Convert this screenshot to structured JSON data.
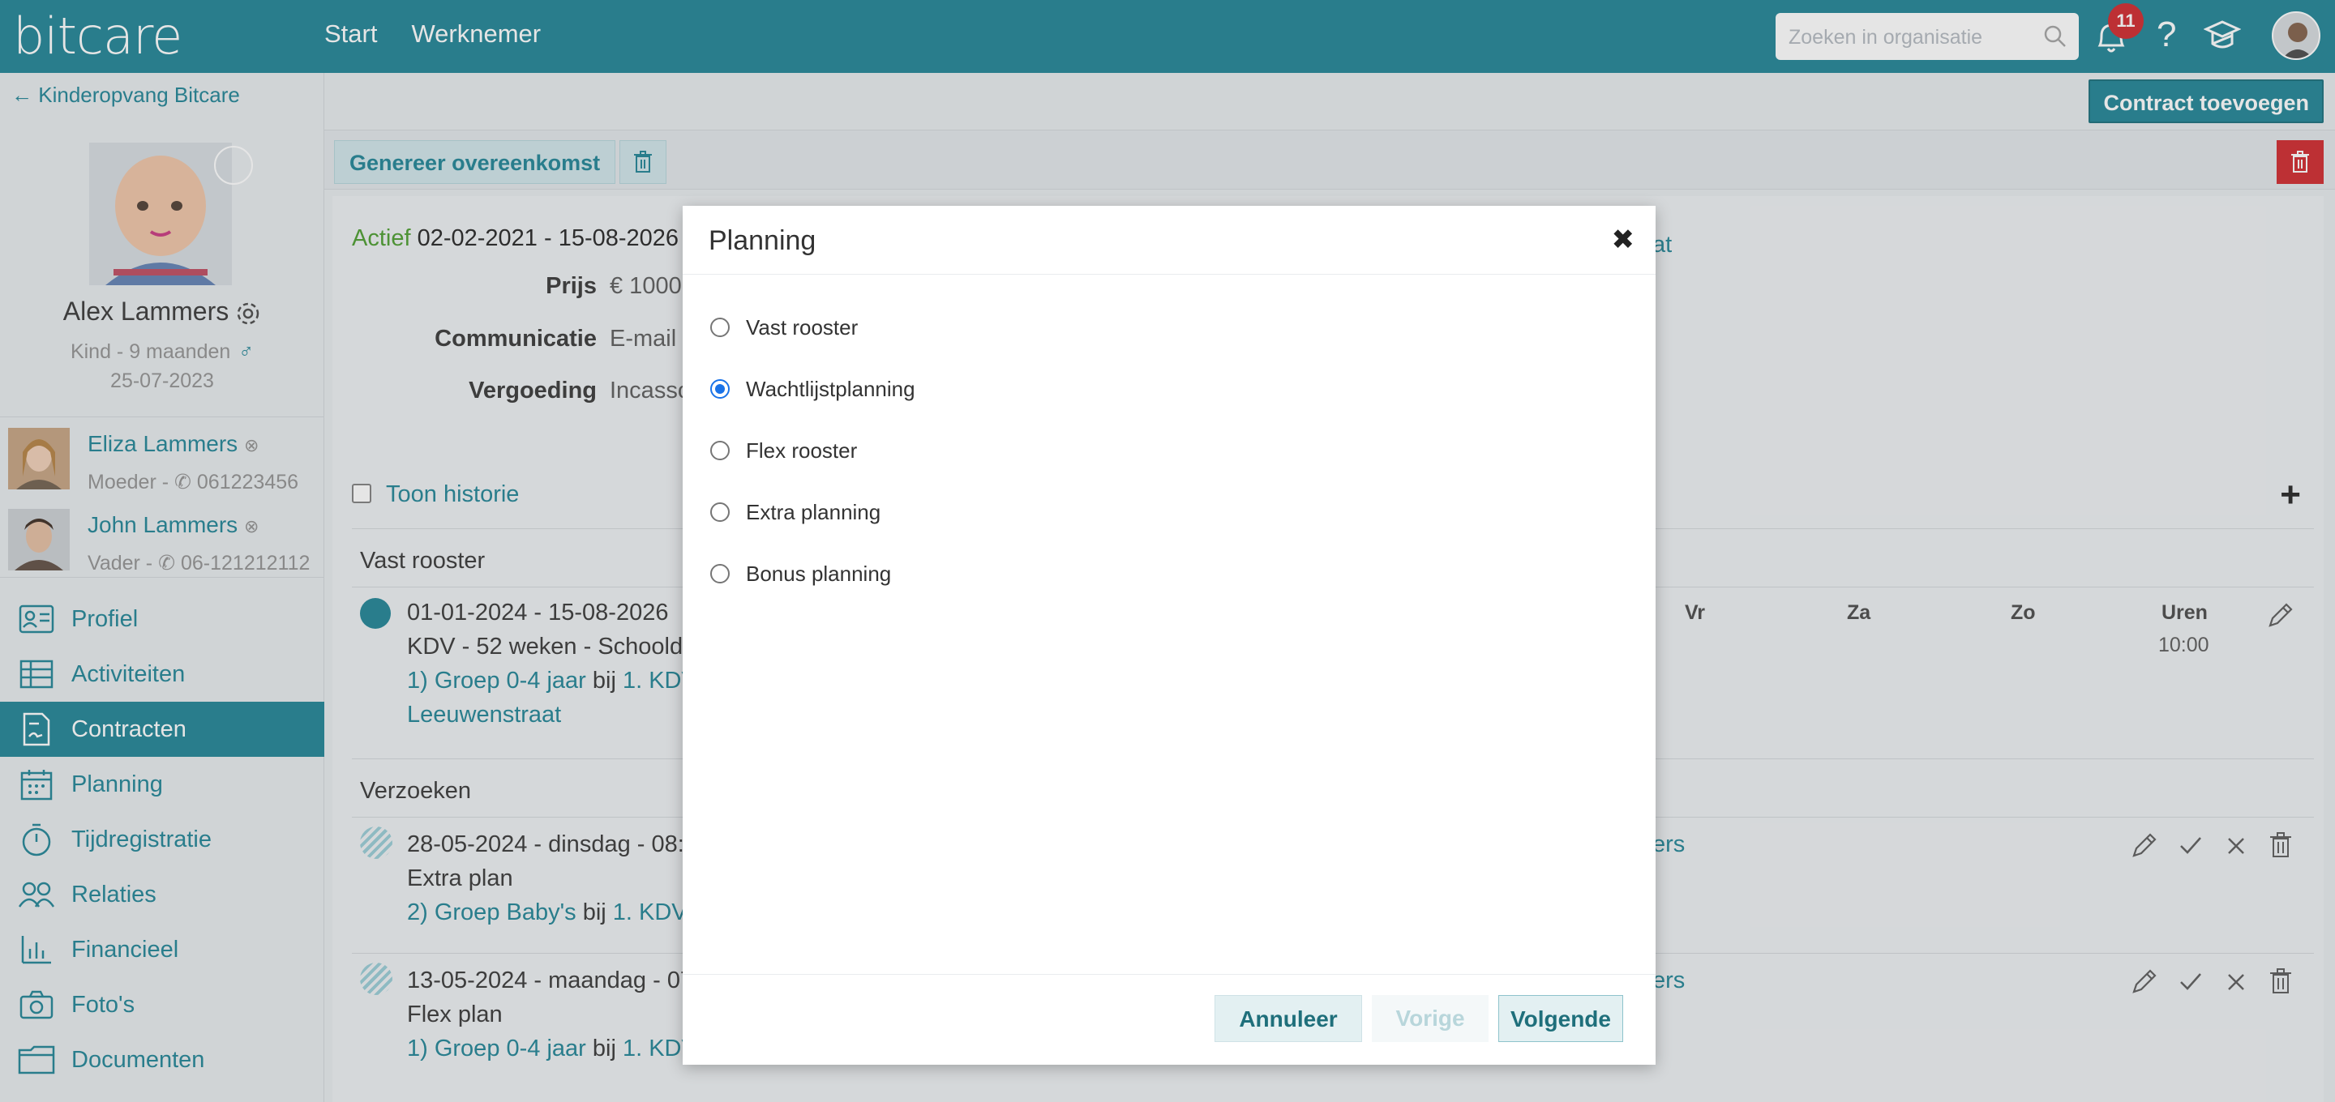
{
  "topbar": {
    "logo": "bitcare",
    "nav": [
      "Start",
      "Werknemer"
    ],
    "search_placeholder": "Zoeken in organisatie",
    "notifications": "11",
    "help": "?"
  },
  "sidebar": {
    "back": "Kinderopvang Bitcare",
    "child": {
      "name": "Alex Lammers",
      "meta": "Kind - 9 maanden",
      "dob": "25-07-2023",
      "gender_icon": "male-icon"
    },
    "parents": [
      {
        "name": "Eliza Lammers",
        "role": "Moeder - ",
        "phone": "061223456"
      },
      {
        "name": "John Lammers",
        "role": "Vader - ",
        "phone": "06-121212112"
      }
    ],
    "menu": [
      {
        "label": "Profiel",
        "icon": "profile-card-icon"
      },
      {
        "label": "Activiteiten",
        "icon": "table-icon"
      },
      {
        "label": "Contracten",
        "icon": "contract-icon",
        "active": true
      },
      {
        "label": "Planning",
        "icon": "calendar-icon"
      },
      {
        "label": "Tijdregistratie",
        "icon": "stopwatch-icon"
      },
      {
        "label": "Relaties",
        "icon": "people-icon"
      },
      {
        "label": "Financieel",
        "icon": "bar-chart-icon"
      },
      {
        "label": "Foto's",
        "icon": "camera-icon"
      },
      {
        "label": "Documenten",
        "icon": "folder-icon"
      }
    ]
  },
  "main": {
    "add_contract": "Contract toevoegen",
    "generate": "Genereer overeenkomst",
    "contract": {
      "status": "Actief",
      "period": "02-02-2021 - 15-08-2026",
      "tail_link": "at",
      "fields": [
        {
          "key": "Prijs",
          "value": "€ 1000"
        },
        {
          "key": "Communicatie",
          "value": "E-mail"
        },
        {
          "key": "Vergoeding",
          "value": "Incasso"
        }
      ]
    },
    "toon_historie": "Toon historie",
    "vast_rooster": {
      "heading": "Vast rooster",
      "period": "01-01-2024 - 15-08-2026",
      "desc": "KDV - 52 weken - Schoolda",
      "group_link": "1) Groep 0-4 jaar",
      "bij": "bij",
      "location_link": "1. KDV",
      "street_link": "Leeuwenstraat",
      "days": [
        "Vr",
        "Za",
        "Zo",
        "Uren"
      ],
      "hours": "10:00"
    },
    "verzoeken": {
      "heading": "Verzoeken",
      "items": [
        {
          "date": "28-05-2024 - dinsdag - 08:0",
          "type": "Extra plan",
          "group_link": "2) Groep Baby's",
          "bij": "bij",
          "location_link": "1. KDV",
          "tail": "ers"
        },
        {
          "date": "13-05-2024 - maandag - 07",
          "type": "Flex plan",
          "group_link": "1) Groep 0-4 jaar",
          "bij": "bij",
          "location_link": "1. KDV",
          "tail": "ers"
        }
      ]
    }
  },
  "modal": {
    "title": "Planning",
    "options": [
      {
        "label": "Vast rooster",
        "checked": false
      },
      {
        "label": "Wachtlijstplanning",
        "checked": true
      },
      {
        "label": "Flex rooster",
        "checked": false
      },
      {
        "label": "Extra planning",
        "checked": false
      },
      {
        "label": "Bonus planning",
        "checked": false
      }
    ],
    "cancel": "Annuleer",
    "prev": "Vorige",
    "next": "Volgende"
  }
}
